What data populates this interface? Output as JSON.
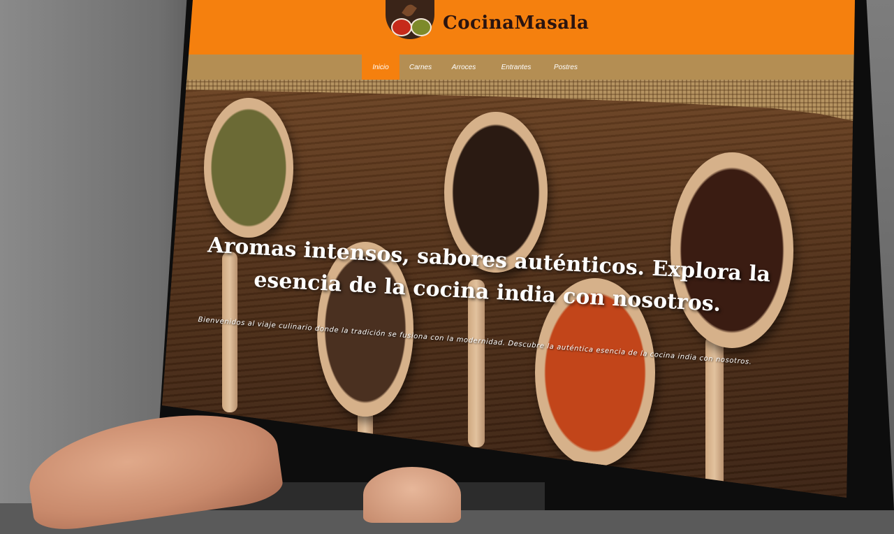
{
  "site": {
    "brand_name": "CocinaMasala"
  },
  "nav": {
    "items": [
      {
        "label": "Inicio",
        "active": true
      },
      {
        "label": "Carnes",
        "active": false
      },
      {
        "label": "Arroces",
        "active": false
      },
      {
        "label": "Entrantes",
        "active": false
      },
      {
        "label": "Postres",
        "active": false
      }
    ]
  },
  "hero": {
    "title": "Aromas intensos, sabores auténticos. Explora la esencia de la cocina india con nosotros.",
    "subtitle": "Bienvenidos al viaje culinario donde la tradición se fusiona con la modernidad. Descubre la auténtica esencia de la cocina india con nosotros."
  },
  "colors": {
    "header_orange": "#f5800e",
    "nav_tan": "#b48e53",
    "brand_text": "#2a1410"
  },
  "icons": {
    "logo": "spice-bowls-icon"
  }
}
